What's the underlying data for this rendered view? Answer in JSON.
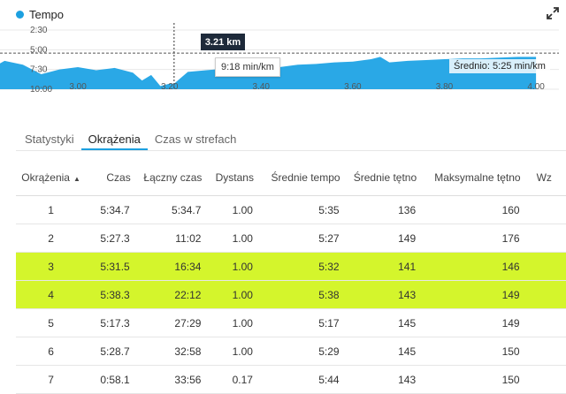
{
  "chart": {
    "title": "Tempo",
    "y_ticks": [
      "2:30",
      "5:00",
      "7:30",
      "10:00"
    ],
    "x_ticks": [
      "3.00",
      "3.20",
      "3.40",
      "3.60",
      "3.80",
      "4.00"
    ],
    "hover_distance": "3.21 km",
    "hover_pace": "9:18 min/km",
    "average_label": "Średnio: 5:25 min/km",
    "colors": {
      "fill": "#2aa8e6",
      "dot": "#1ca0e0"
    }
  },
  "chart_data": {
    "type": "area",
    "x_unit": "km",
    "y_unit": "min/km",
    "y_axis_inverted": true,
    "ylim": [
      "2:30",
      "10:00"
    ],
    "x": [
      2.8,
      2.84,
      2.88,
      2.92,
      2.96,
      3.0,
      3.04,
      3.08,
      3.12,
      3.14,
      3.16,
      3.18,
      3.2,
      3.21,
      3.22,
      3.24,
      3.28,
      3.32,
      3.36,
      3.4,
      3.44,
      3.48,
      3.52,
      3.56,
      3.6,
      3.64,
      3.66,
      3.68,
      3.72,
      3.76,
      3.8,
      3.84,
      3.88,
      3.92,
      3.96,
      4.0
    ],
    "y": [
      7.7,
      6.4,
      6.9,
      8.1,
      7.5,
      7.2,
      7.6,
      7.3,
      7.9,
      8.9,
      8.2,
      9.6,
      9.3,
      9.3,
      8.8,
      7.8,
      7.6,
      7.4,
      7.3,
      7.1,
      7.2,
      6.9,
      6.8,
      6.6,
      6.5,
      6.2,
      5.9,
      6.6,
      6.4,
      6.3,
      6.2,
      6.1,
      6.1,
      6.0,
      5.9,
      5.9
    ],
    "average": 5.42
  },
  "tabs": [
    {
      "label": "Statystyki",
      "active": false
    },
    {
      "label": "Okrążenia",
      "active": true
    },
    {
      "label": "Czas w strefach",
      "active": false
    }
  ],
  "table": {
    "sort_column": "Okrążenia",
    "headers": [
      "Okrążenia",
      "Czas",
      "Łączny czas",
      "Dystans",
      "Średnie tempo",
      "Średnie tętno",
      "Maksymalne tętno",
      "Wz"
    ],
    "highlight_color": "#d4f52c",
    "rows": [
      {
        "lap": "1",
        "time": "5:34.7",
        "total": "5:34.7",
        "dist": "1.00",
        "pace": "5:35",
        "hr": "136",
        "maxhr": "160"
      },
      {
        "lap": "2",
        "time": "5:27.3",
        "total": "11:02",
        "dist": "1.00",
        "pace": "5:27",
        "hr": "149",
        "maxhr": "176"
      },
      {
        "lap": "3",
        "time": "5:31.5",
        "total": "16:34",
        "dist": "1.00",
        "pace": "5:32",
        "hr": "141",
        "maxhr": "146"
      },
      {
        "lap": "4",
        "time": "5:38.3",
        "total": "22:12",
        "dist": "1.00",
        "pace": "5:38",
        "hr": "143",
        "maxhr": "149"
      },
      {
        "lap": "5",
        "time": "5:17.3",
        "total": "27:29",
        "dist": "1.00",
        "pace": "5:17",
        "hr": "145",
        "maxhr": "149"
      },
      {
        "lap": "6",
        "time": "5:28.7",
        "total": "32:58",
        "dist": "1.00",
        "pace": "5:29",
        "hr": "145",
        "maxhr": "150"
      },
      {
        "lap": "7",
        "time": "0:58.1",
        "total": "33:56",
        "dist": "0.17",
        "pace": "5:44",
        "hr": "143",
        "maxhr": "150"
      }
    ]
  }
}
